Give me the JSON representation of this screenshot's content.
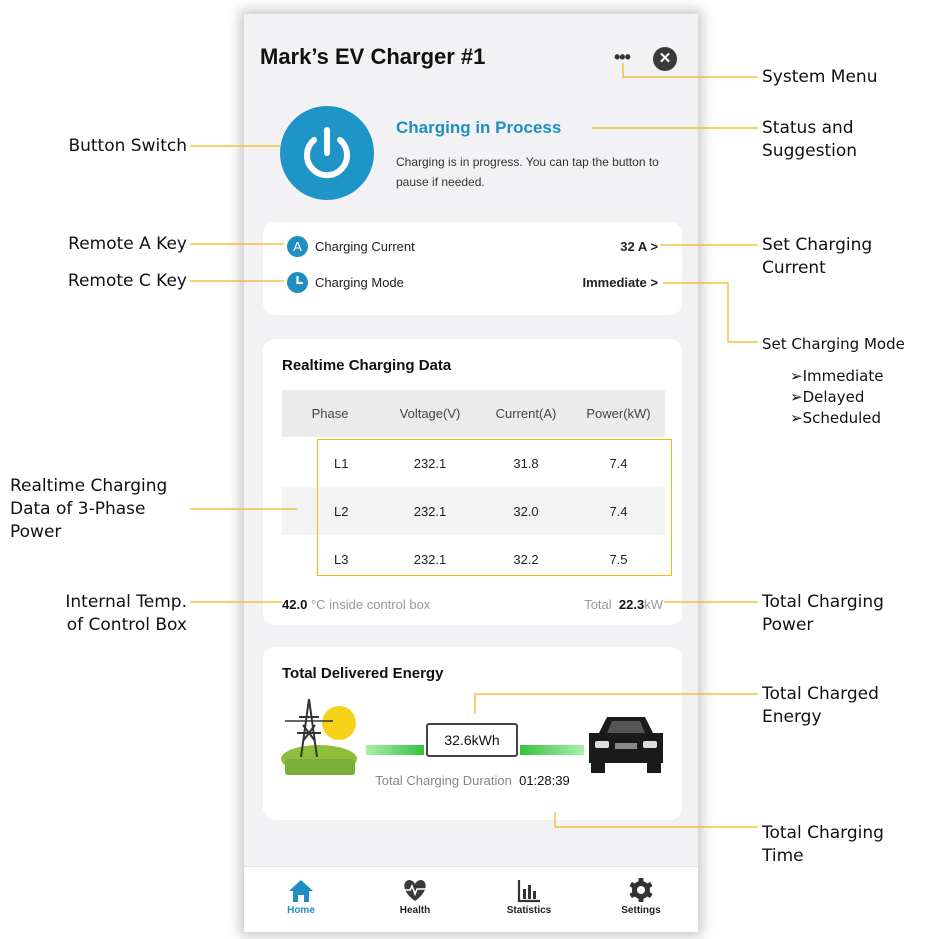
{
  "header": {
    "title": "Mark’s EV Charger #1"
  },
  "status": {
    "title": "Charging in Process",
    "description": "Charging is in progress. You can tap the button to pause if needed."
  },
  "settings": {
    "current_badge": "A",
    "current_label": "Charging Current",
    "current_value": "32 A >",
    "mode_label": "Charging Mode",
    "mode_value": "Immediate >"
  },
  "realtime": {
    "title": "Realtime Charging Data",
    "headers": [
      "Phase",
      "Voltage(V)",
      "Current(A)",
      "Power(kW)"
    ],
    "rows": [
      [
        "L1",
        "232.1",
        "31.8",
        "7.4"
      ],
      [
        "L2",
        "232.1",
        "32.0",
        "7.4"
      ],
      [
        "L3",
        "232.1",
        "32.2",
        "7.5"
      ]
    ],
    "temp_value": "42.0",
    "temp_label": "°C inside control box",
    "total_label": "Total",
    "total_value": "22.3",
    "total_unit": "kW"
  },
  "energy": {
    "title": "Total Delivered Energy",
    "value": "32.6",
    "unit": "kWh",
    "duration_label": "Total Charging Duration",
    "duration_value": "01:28:39"
  },
  "tabs": [
    {
      "label": "Home",
      "icon": "home-icon",
      "active": true
    },
    {
      "label": "Health",
      "icon": "heartbeat-icon"
    },
    {
      "label": "Statistics",
      "icon": "bar-chart-icon"
    },
    {
      "label": "Settings",
      "icon": "gear-icon"
    }
  ],
  "annotations": {
    "system_menu": "System Menu",
    "status_line1": "Status and",
    "status_line2": "Suggestion",
    "set_current_line1": "Set Charging",
    "set_current_line2": "Current",
    "set_mode": "Set Charging Mode",
    "mode_options": [
      "Immediate",
      "Delayed",
      "Scheduled"
    ],
    "total_power_line1": "Total Charging",
    "total_power_line2": "Power",
    "total_energy_line1": "Total  Charged",
    "total_energy_line2": "Energy",
    "total_time_line1": "Total  Charging",
    "total_time_line2": "Time",
    "button_switch": "Button Switch",
    "remote_a": "Remote A Key",
    "remote_c": "Remote C Key",
    "realtime_line1": "Realtime Charging",
    "realtime_line2": "Data   of   3-Phase",
    "realtime_line3": "Power",
    "temp_line1": "Internal Temp.",
    "temp_line2": "of Control Box"
  },
  "colors": {
    "accent": "#1e8fc0",
    "highlight": "#f2b617",
    "bar_green": "#5ed96a"
  }
}
